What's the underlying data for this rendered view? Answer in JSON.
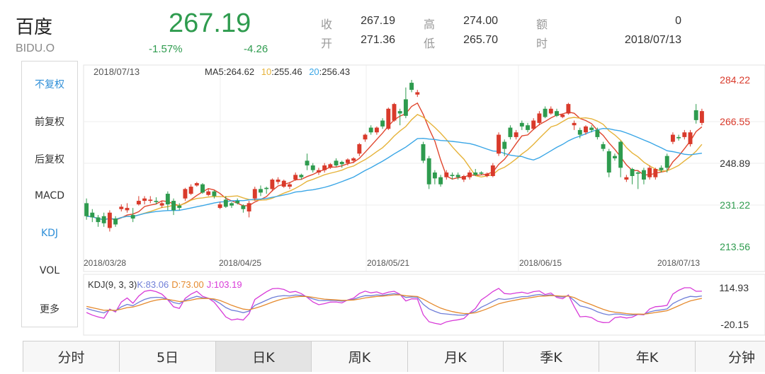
{
  "stock": {
    "name": "百度",
    "code": "BIDU.O",
    "price": "267.19",
    "change_pct": "-1.57%",
    "change": "-4.26"
  },
  "quote": {
    "close_label": "收",
    "close_value": "267.19",
    "open_label": "开",
    "open_value": "271.36",
    "high_label": "高",
    "high_value": "274.00",
    "low_label": "低",
    "low_value": "265.70",
    "amount_label": "额",
    "amount_value": "0",
    "time_label": "时",
    "time_value": "2018/07/13"
  },
  "sidebar": {
    "items": [
      {
        "label": "不复权",
        "active": true
      },
      {
        "label": "前复权",
        "active": false
      },
      {
        "label": "后复权",
        "active": false
      },
      {
        "label": "MACD",
        "active": false
      },
      {
        "label": "KDJ",
        "active": true
      },
      {
        "label": "VOL",
        "active": false
      },
      {
        "label": "更多",
        "active": false
      }
    ]
  },
  "tabs": [
    {
      "label": "分时",
      "active": false
    },
    {
      "label": "5日",
      "active": false
    },
    {
      "label": "日K",
      "active": true
    },
    {
      "label": "周K",
      "active": false
    },
    {
      "label": "月K",
      "active": false
    },
    {
      "label": "季K",
      "active": false
    },
    {
      "label": "年K",
      "active": false
    },
    {
      "label": "分钟",
      "active": false
    }
  ],
  "colors": {
    "up": "#d93a2b",
    "down": "#2e9b4e",
    "ma5": "#e0462e",
    "ma10": "#e6b33a",
    "ma20": "#3aa6e6",
    "kdj_k": "#6f7ed8",
    "kdj_d": "#e58a2e",
    "kdj_j": "#d83ad8",
    "active_side": "#2f8fd8"
  },
  "chart_data": {
    "type": "candlestick",
    "date_label": "2018/07/13",
    "ma": {
      "ma5_label": "MA5",
      "ma5_value": ":264.62",
      "ma10_label": "10",
      "ma10_value": ":255.46",
      "ma20_label": "20",
      "ma20_value": ":256.43"
    },
    "y_ticks": [
      "284.22",
      "266.55",
      "248.89",
      "231.22",
      "213.56"
    ],
    "y_tick_values": [
      284.22,
      266.55,
      248.89,
      231.22,
      213.56
    ],
    "x_tick_labels": [
      "2018/03/28",
      "2018/04/25",
      "2018/05/21",
      "2018/06/15",
      "2018/07/13"
    ],
    "ylim": [
      213.56,
      284.22
    ],
    "candles": [
      [
        232.0,
        226.5,
        234.0,
        225.0
      ],
      [
        228.0,
        226.0,
        229.5,
        224.0
      ],
      [
        226.0,
        224.0,
        227.0,
        222.0
      ],
      [
        226.5,
        223.5,
        228.0,
        222.0
      ],
      [
        221.5,
        228.0,
        229.0,
        220.0
      ],
      [
        225.5,
        223.0,
        226.5,
        222.0
      ],
      [
        229.5,
        230.5,
        231.5,
        228.5
      ],
      [
        229.0,
        230.0,
        232.0,
        228.0
      ],
      [
        227.0,
        225.5,
        230.0,
        224.0
      ],
      [
        231.5,
        233.0,
        235.0,
        231.0
      ],
      [
        233.0,
        234.0,
        235.0,
        231.5
      ],
      [
        233.0,
        233.5,
        235.0,
        232.0
      ],
      [
        233.0,
        232.5,
        234.5,
        231.5
      ],
      [
        231.0,
        232.0,
        233.0,
        230.0
      ],
      [
        236.0,
        231.5,
        237.0,
        229.0
      ],
      [
        233.0,
        229.0,
        234.0,
        227.0
      ],
      [
        231.0,
        230.0,
        232.0,
        229.0
      ],
      [
        234.0,
        238.0,
        238.5,
        233.0
      ],
      [
        236.0,
        239.0,
        240.0,
        235.5
      ],
      [
        239.5,
        240.5,
        241.0,
        239.0
      ],
      [
        240.0,
        236.5,
        240.5,
        236.0
      ],
      [
        235.5,
        237.0,
        238.0,
        235.0
      ],
      [
        237.0,
        235.0,
        237.5,
        234.0
      ],
      [
        230.0,
        231.5,
        232.5,
        229.5
      ],
      [
        233.5,
        230.5,
        235.0,
        230.0
      ],
      [
        232.0,
        231.0,
        232.5,
        230.0
      ],
      [
        233.0,
        232.0,
        234.0,
        231.5
      ],
      [
        231.0,
        229.5,
        231.5,
        228.0
      ],
      [
        228.5,
        232.0,
        233.0,
        226.0
      ],
      [
        234.0,
        238.0,
        239.0,
        233.0
      ],
      [
        238.0,
        236.5,
        239.5,
        235.0
      ],
      [
        238.5,
        238.0,
        239.0,
        236.0
      ],
      [
        238.0,
        242.0,
        242.5,
        237.0
      ],
      [
        241.0,
        242.0,
        243.0,
        240.0
      ],
      [
        239.0,
        241.5,
        242.0,
        238.5
      ],
      [
        239.0,
        240.0,
        241.0,
        238.0
      ],
      [
        242.0,
        244.0,
        245.0,
        241.5
      ],
      [
        244.0,
        243.0,
        244.5,
        242.0
      ],
      [
        250.0,
        248.0,
        253.0,
        246.0
      ],
      [
        248.0,
        246.0,
        249.0,
        245.0
      ],
      [
        245.0,
        246.0,
        247.0,
        244.0
      ],
      [
        246.0,
        248.0,
        249.0,
        245.0
      ],
      [
        247.0,
        248.5,
        249.0,
        246.5
      ],
      [
        250.0,
        248.0,
        251.0,
        247.5
      ],
      [
        249.5,
        248.5,
        250.0,
        247.0
      ],
      [
        249.0,
        250.5,
        251.0,
        248.0
      ],
      [
        250.0,
        251.0,
        251.5,
        249.0
      ],
      [
        253.0,
        257.0,
        257.5,
        252.0
      ],
      [
        259.0,
        261.0,
        261.5,
        258.0
      ],
      [
        264.0,
        262.0,
        265.0,
        261.0
      ],
      [
        262.0,
        264.0,
        264.5,
        261.0
      ],
      [
        267.0,
        264.5,
        268.0,
        263.5
      ],
      [
        263.5,
        272.0,
        272.5,
        263.0
      ],
      [
        267.0,
        274.0,
        274.5,
        266.5
      ],
      [
        271.0,
        270.0,
        272.0,
        265.0
      ],
      [
        276.0,
        269.0,
        281.0,
        268.0
      ],
      [
        283.0,
        280.0,
        284.22,
        279.0
      ],
      [
        278.0,
        279.0,
        280.0,
        277.0
      ],
      [
        257.0,
        250.0,
        258.0,
        249.0
      ],
      [
        251.0,
        240.0,
        252.0,
        238.0
      ],
      [
        245.0,
        242.5,
        246.0,
        240.0
      ],
      [
        243.0,
        240.0,
        244.0,
        239.0
      ],
      [
        243.0,
        245.0,
        246.0,
        242.0
      ],
      [
        244.0,
        243.5,
        245.0,
        242.0
      ],
      [
        244.0,
        243.0,
        245.0,
        242.0
      ],
      [
        242.0,
        243.5,
        244.0,
        241.0
      ],
      [
        243.0,
        245.0,
        246.0,
        242.0
      ],
      [
        245.0,
        244.0,
        246.5,
        243.5
      ],
      [
        245.0,
        244.5,
        245.5,
        244.0
      ],
      [
        243.5,
        244.5,
        245.0,
        243.0
      ],
      [
        243.5,
        248.0,
        249.0,
        243.0
      ],
      [
        253.0,
        261.0,
        262.0,
        252.0
      ],
      [
        258.0,
        255.0,
        259.0,
        252.0
      ],
      [
        264.0,
        260.0,
        265.0,
        259.0
      ],
      [
        260.0,
        262.0,
        263.0,
        259.0
      ],
      [
        266.0,
        264.5,
        267.0,
        263.0
      ],
      [
        265.0,
        263.0,
        266.0,
        262.0
      ],
      [
        263.5,
        267.0,
        268.0,
        263.0
      ],
      [
        266.0,
        270.0,
        271.0,
        265.0
      ],
      [
        272.0,
        268.5,
        273.0,
        268.0
      ],
      [
        270.0,
        272.0,
        273.0,
        269.5
      ],
      [
        271.0,
        269.0,
        272.0,
        268.5
      ],
      [
        268.5,
        269.5,
        270.0,
        268.0
      ],
      [
        270.0,
        274.0,
        274.5,
        269.5
      ],
      [
        265.0,
        266.0,
        267.0,
        263.0
      ],
      [
        263.0,
        261.0,
        264.0,
        259.5
      ],
      [
        262.0,
        264.5,
        265.0,
        261.0
      ],
      [
        264.0,
        263.0,
        265.0,
        262.0
      ],
      [
        263.0,
        260.0,
        264.0,
        259.0
      ],
      [
        257.0,
        255.0,
        258.0,
        254.0
      ],
      [
        254.0,
        245.0,
        255.0,
        243.0
      ],
      [
        252.0,
        251.0,
        253.0,
        250.0
      ],
      [
        258.0,
        247.0,
        258.5,
        243.0
      ],
      [
        242.0,
        243.0,
        244.0,
        241.0
      ],
      [
        246.5,
        243.5,
        247.0,
        240.0
      ],
      [
        245.0,
        244.5,
        245.5,
        238.0
      ],
      [
        246.0,
        242.0,
        247.0,
        240.0
      ],
      [
        243.0,
        247.0,
        248.0,
        242.0
      ],
      [
        243.0,
        246.5,
        247.0,
        242.0
      ],
      [
        247.0,
        246.0,
        248.0,
        245.0
      ],
      [
        252.0,
        247.0,
        253.0,
        245.0
      ],
      [
        258.0,
        261.0,
        262.0,
        257.0
      ],
      [
        260.0,
        259.5,
        261.0,
        258.5
      ],
      [
        260.0,
        262.0,
        263.0,
        259.0
      ],
      [
        257.0,
        262.0,
        263.0,
        256.0
      ],
      [
        271.36,
        267.19,
        274.0,
        265.7
      ],
      [
        266.0,
        271.0,
        272.0,
        265.0
      ]
    ],
    "candle_fields": [
      "open",
      "close",
      "high",
      "low"
    ],
    "kdj": {
      "label": "KDJ(9, 3, 3)",
      "k_text": "K:83.06",
      "d_text": "D:73.00",
      "j_text": "J:103.19",
      "y_ticks": [
        "114.93",
        "-20.15"
      ],
      "ylim": [
        -20.15,
        114.93
      ]
    }
  }
}
